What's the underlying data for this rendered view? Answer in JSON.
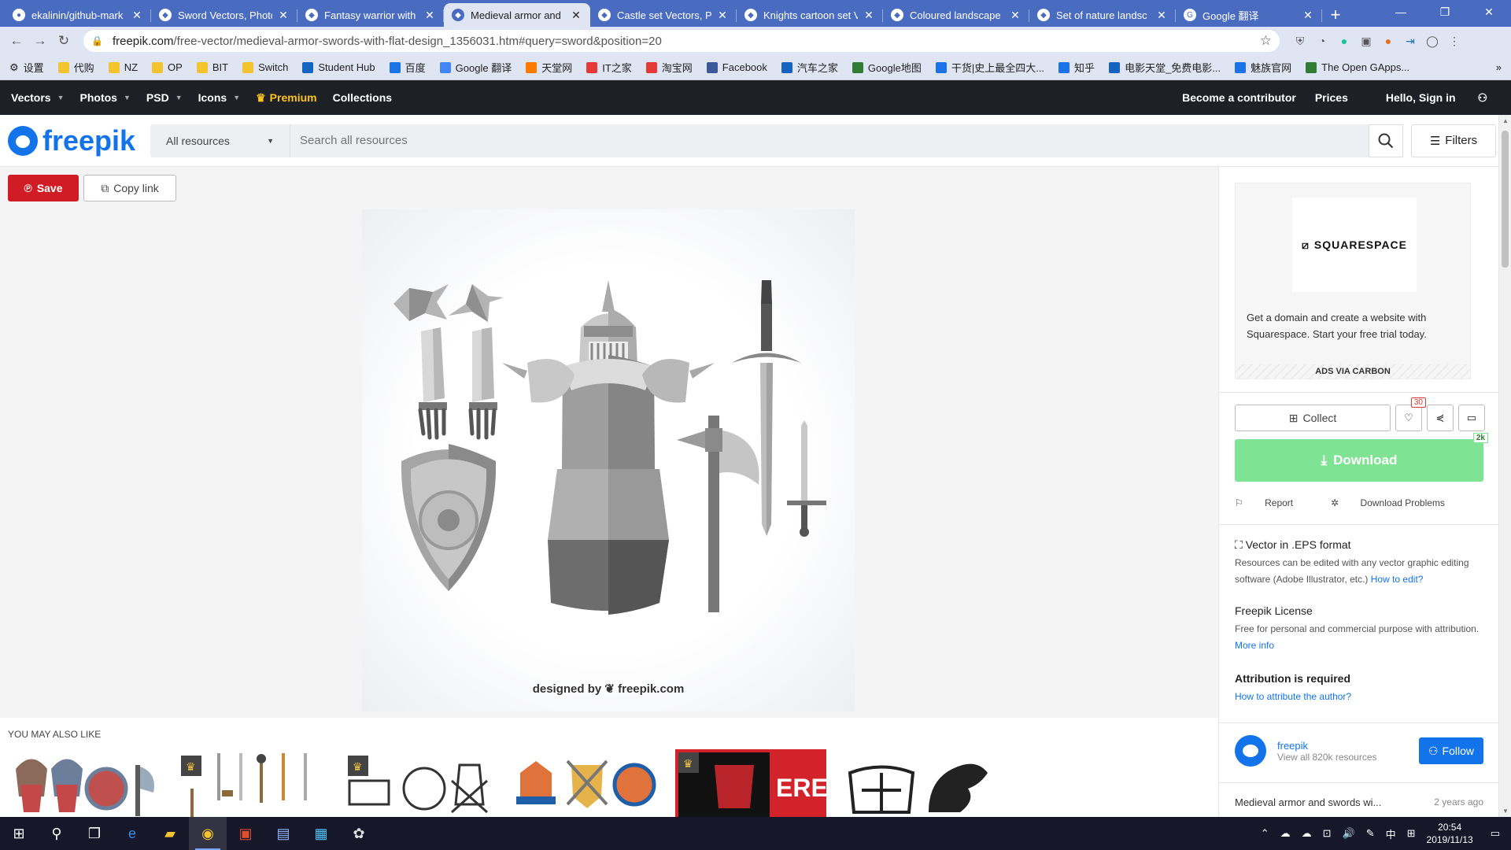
{
  "browser": {
    "tabs": [
      {
        "title": "ekalinin/github-mark",
        "active": false
      },
      {
        "title": "Sword Vectors, Photo",
        "active": false
      },
      {
        "title": "Fantasy warrior with",
        "active": false
      },
      {
        "title": "Medieval armor and",
        "active": true
      },
      {
        "title": "Castle set Vectors, Ph",
        "active": false
      },
      {
        "title": "Knights cartoon set V",
        "active": false
      },
      {
        "title": "Coloured landscape",
        "active": false
      },
      {
        "title": "Set of nature landsc",
        "active": false
      },
      {
        "title": "Google 翻译",
        "active": false
      }
    ],
    "new_tab": "+",
    "url_domain": "freepik.com",
    "url_path": "/free-vector/medieval-armor-swords-with-flat-design_1356031.htm#query=sword&position=20",
    "bookmarks": [
      "设置",
      "代购",
      "NZ",
      "OP",
      "BIT",
      "Switch",
      "Student Hub",
      "百度",
      "Google 翻译",
      "天堂网",
      "IT之家",
      "淘宝网",
      "Facebook",
      "汽车之家",
      "Google地图",
      "干货|史上最全四大...",
      "知乎",
      "电影天堂_免费电影...",
      "魅族官网",
      "The Open GApps..."
    ]
  },
  "nav": {
    "items": [
      "Vectors",
      "Photos",
      "PSD",
      "Icons"
    ],
    "premium": "Premium",
    "collections": "Collections",
    "become_contributor": "Become a contributor",
    "prices": "Prices",
    "signin": "Hello, Sign in"
  },
  "header": {
    "logo": "freepik",
    "category": "All resources",
    "search_placeholder": "Search all resources",
    "filters": "Filters"
  },
  "main": {
    "save": "Save",
    "copy_link": "Copy link",
    "credit": "designed by ❦ freepik.com",
    "also_like": "YOU MAY ALSO LIKE"
  },
  "sidebar": {
    "ad_brand": "SQUARESPACE",
    "ad_text": "Get a domain and create a website with Squarespace. Start your free trial today.",
    "ad_footer": "ADS VIA CARBON",
    "collect": "Collect",
    "likes": "30",
    "download": "Download",
    "downloads_badge": "2k",
    "report": "Report",
    "download_problems": "Download Problems",
    "format_title": "Vector in .EPS format",
    "format_text": "Resources can be edited with any vector graphic editing software (Adobe Illustrator, etc.)",
    "how_edit": "How to edit?",
    "license_title": "Freepik License",
    "license_text": "Free for personal and commercial purpose with attribution.",
    "more_info": "More info",
    "attrib_title": "Attribution is required",
    "attrib_link": "How to attribute the author?",
    "author_name": "freepik",
    "author_resources": "View all 820k resources",
    "follow": "Follow",
    "item_title": "Medieval armor and swords wi...",
    "item_age": "2 years ago"
  },
  "taskbar": {
    "time": "20:54",
    "date": "2019/11/13",
    "ime": "中"
  },
  "colors": {
    "chrome_blue": "#4a6cc0",
    "freepik_blue": "#1273eb",
    "save_red": "#d21c25",
    "download_green": "#7ee393",
    "premium_gold": "#fcc419"
  }
}
